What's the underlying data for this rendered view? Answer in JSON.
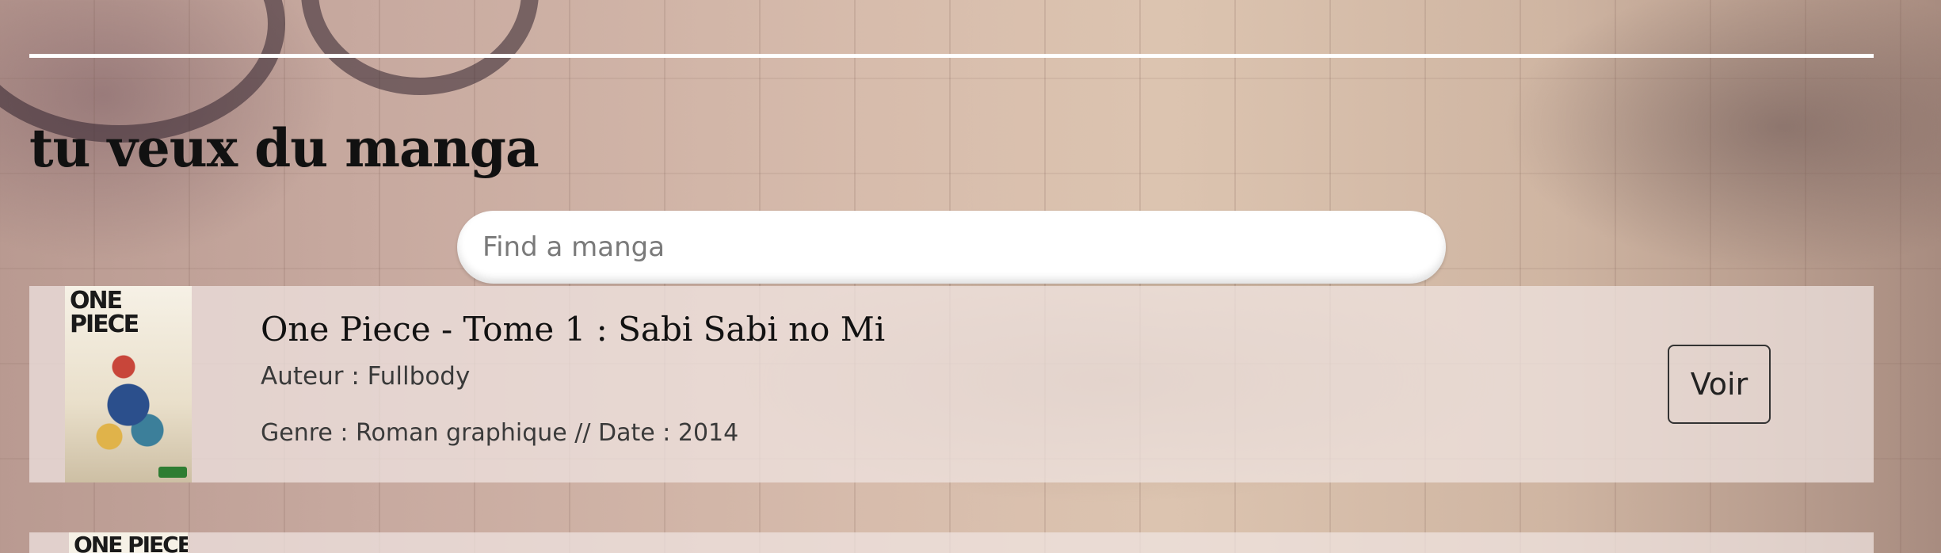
{
  "page": {
    "title": "tu veux du manga"
  },
  "search": {
    "placeholder": "Find a manga",
    "value": ""
  },
  "results": [
    {
      "cover_text": "ONE PIECE",
      "title": "One Piece - Tome 1 : Sabi Sabi no Mi",
      "author": "Auteur : Fullbody",
      "meta": "Genre : Roman graphique // Date : 2014",
      "action_label": "Voir"
    },
    {
      "cover_text": "ONE PIECE"
    }
  ],
  "colors": {
    "divider": "#ffffff",
    "card_background": "#f0e4e2",
    "text_primary": "#111111",
    "text_secondary": "#3a3a3a"
  }
}
